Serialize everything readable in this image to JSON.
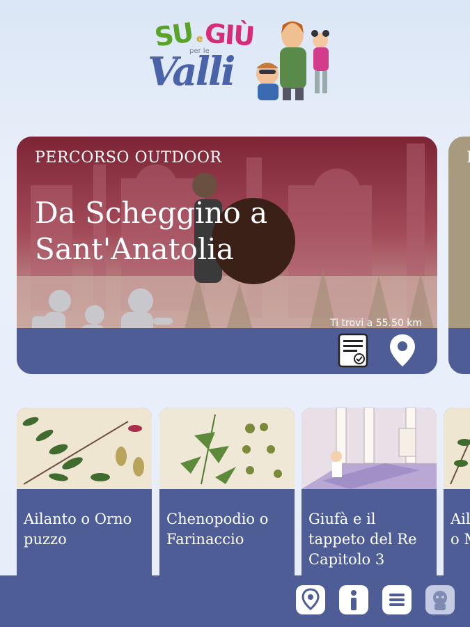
{
  "logo": {
    "su": "SU",
    "e": "e",
    "giu": "GIÙ",
    "per": "per le",
    "valli": "Valli"
  },
  "hero": {
    "tag": "PERCORSO OUTDOOR",
    "title": "Da Scheggino a Sant'Anatolia",
    "distance": "Ti trovi a 55.50 km"
  },
  "peek": {
    "tag": "P"
  },
  "cards": [
    {
      "title": "Ailanto o Orno puzzo"
    },
    {
      "title": "Chenopodio o Farinaccio"
    },
    {
      "title": "Giufà e il tappeto del Re Capitolo 3"
    },
    {
      "title": "Ail o M"
    }
  ],
  "colors": {
    "bar": "#4e5d95",
    "hero_top": "#7d2536",
    "white": "#ffffff"
  },
  "nav": {
    "icons": [
      "map-pin-icon",
      "info-icon",
      "menu-icon",
      "character-icon"
    ]
  }
}
